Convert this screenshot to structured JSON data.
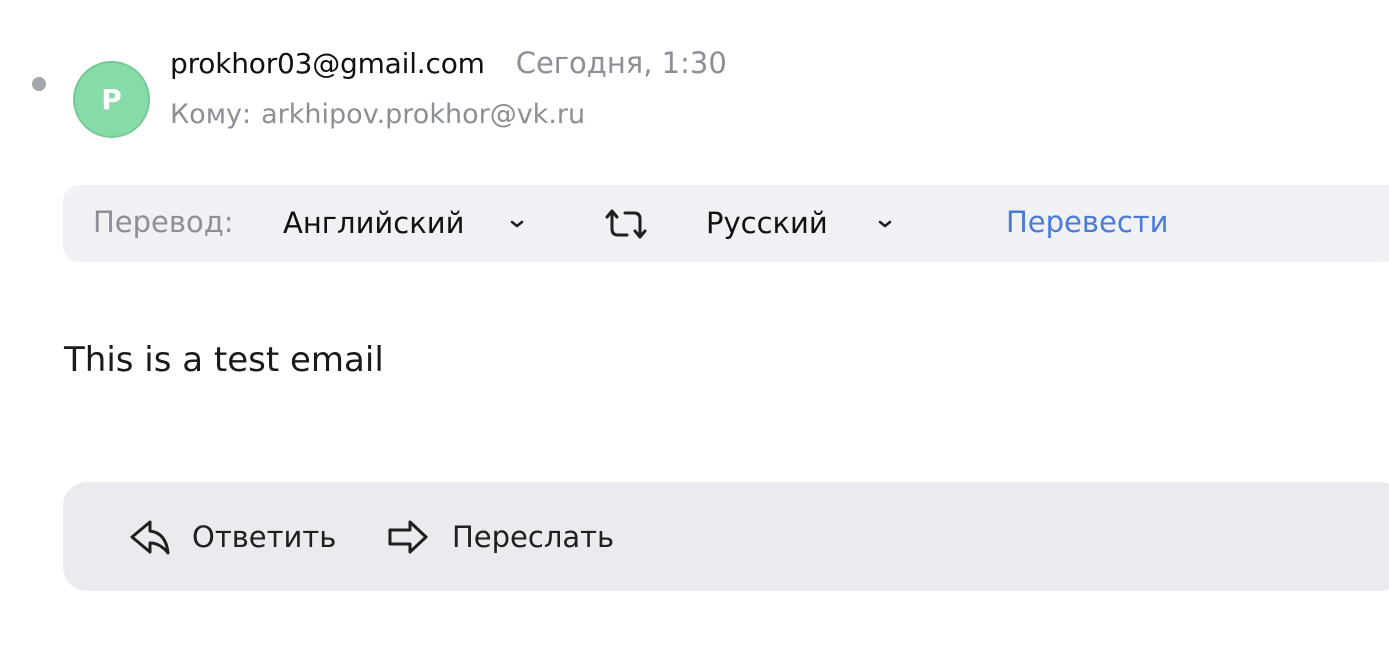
{
  "header": {
    "avatar_letter": "P",
    "avatar_color": "#86dba8",
    "sender": "prokhor03@gmail.com",
    "date": "Сегодня, 1:30",
    "to_label": "Кому:",
    "recipient": "arkhipov.prokhor@vk.ru"
  },
  "translate_bar": {
    "label": "Перевод:",
    "source_language": "Английский",
    "target_language": "Русский",
    "swap_icon": "swap-arrows-icon",
    "dropdown_icon": "chevron-down-icon",
    "translate_action": "Перевести",
    "link_color": "#4b7bd9"
  },
  "message": {
    "body": "This is a test email"
  },
  "actions": {
    "reply_label": "Ответить",
    "reply_icon": "reply-arrow-icon",
    "forward_label": "Переслать",
    "forward_icon": "forward-arrow-icon"
  }
}
